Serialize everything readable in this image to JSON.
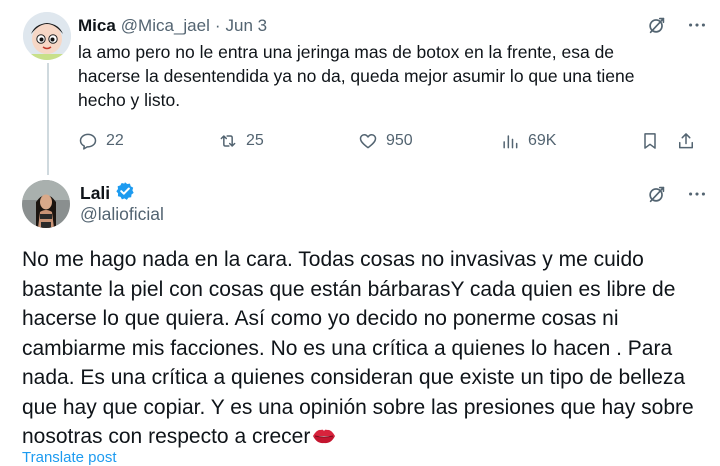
{
  "reply_tweet": {
    "author_name": "Mica",
    "author_handle": "@Mica_jael",
    "separator": "·",
    "date": "Jun 3",
    "text": "la amo pero no le entra una jeringa mas de botox en la frente, esa de hacerse la desentendida ya no da, queda mejor asumir lo que una tiene hecho y listo.",
    "actions": {
      "replies": "22",
      "retweets": "25",
      "likes": "950",
      "views": "69K"
    }
  },
  "main_tweet": {
    "author_name": "Lali",
    "author_handle": "@lalioficial",
    "verified": true,
    "text": "No me hago nada en la cara. Todas cosas no invasivas y me cuido bastante la piel con cosas que están bárbarasY cada quien es libre de hacerse lo que quiera. Así como yo decido no ponerme cosas ni cambiarme mis facciones. No es una crítica a quienes lo hacen . Para nada. Es una crítica a quienes consideran que existe un tipo de belleza que hay que copiar. Y es una opinión sobre las presiones que hay sobre nosotras con respecto a crecer",
    "trailing_emoji": "kiss-mark-icon",
    "translate_label": "Translate post"
  },
  "colors": {
    "text": "#0f1419",
    "muted": "#536471",
    "accent": "#1d9bf0",
    "thread_line": "#cfd9de"
  }
}
